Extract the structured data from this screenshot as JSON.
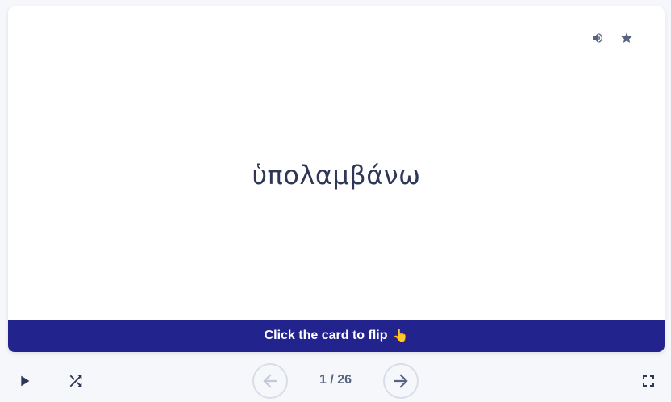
{
  "card": {
    "term": "ὑπολαμβάνω",
    "hint_text": "Click the card to flip",
    "hint_emoji": "👆",
    "icons": {
      "audio": "speaker-icon",
      "star": "star-icon"
    }
  },
  "controls": {
    "counter": "1 / 26",
    "icons": {
      "play": "play-icon",
      "shuffle": "shuffle-icon",
      "prev": "arrow-left-icon",
      "next": "arrow-right-icon",
      "fullscreen": "fullscreen-icon"
    }
  },
  "colors": {
    "hint_bar": "#23238e",
    "text_primary": "#2e3856",
    "icon_gray": "#586380",
    "disabled": "#c2c8d6"
  }
}
